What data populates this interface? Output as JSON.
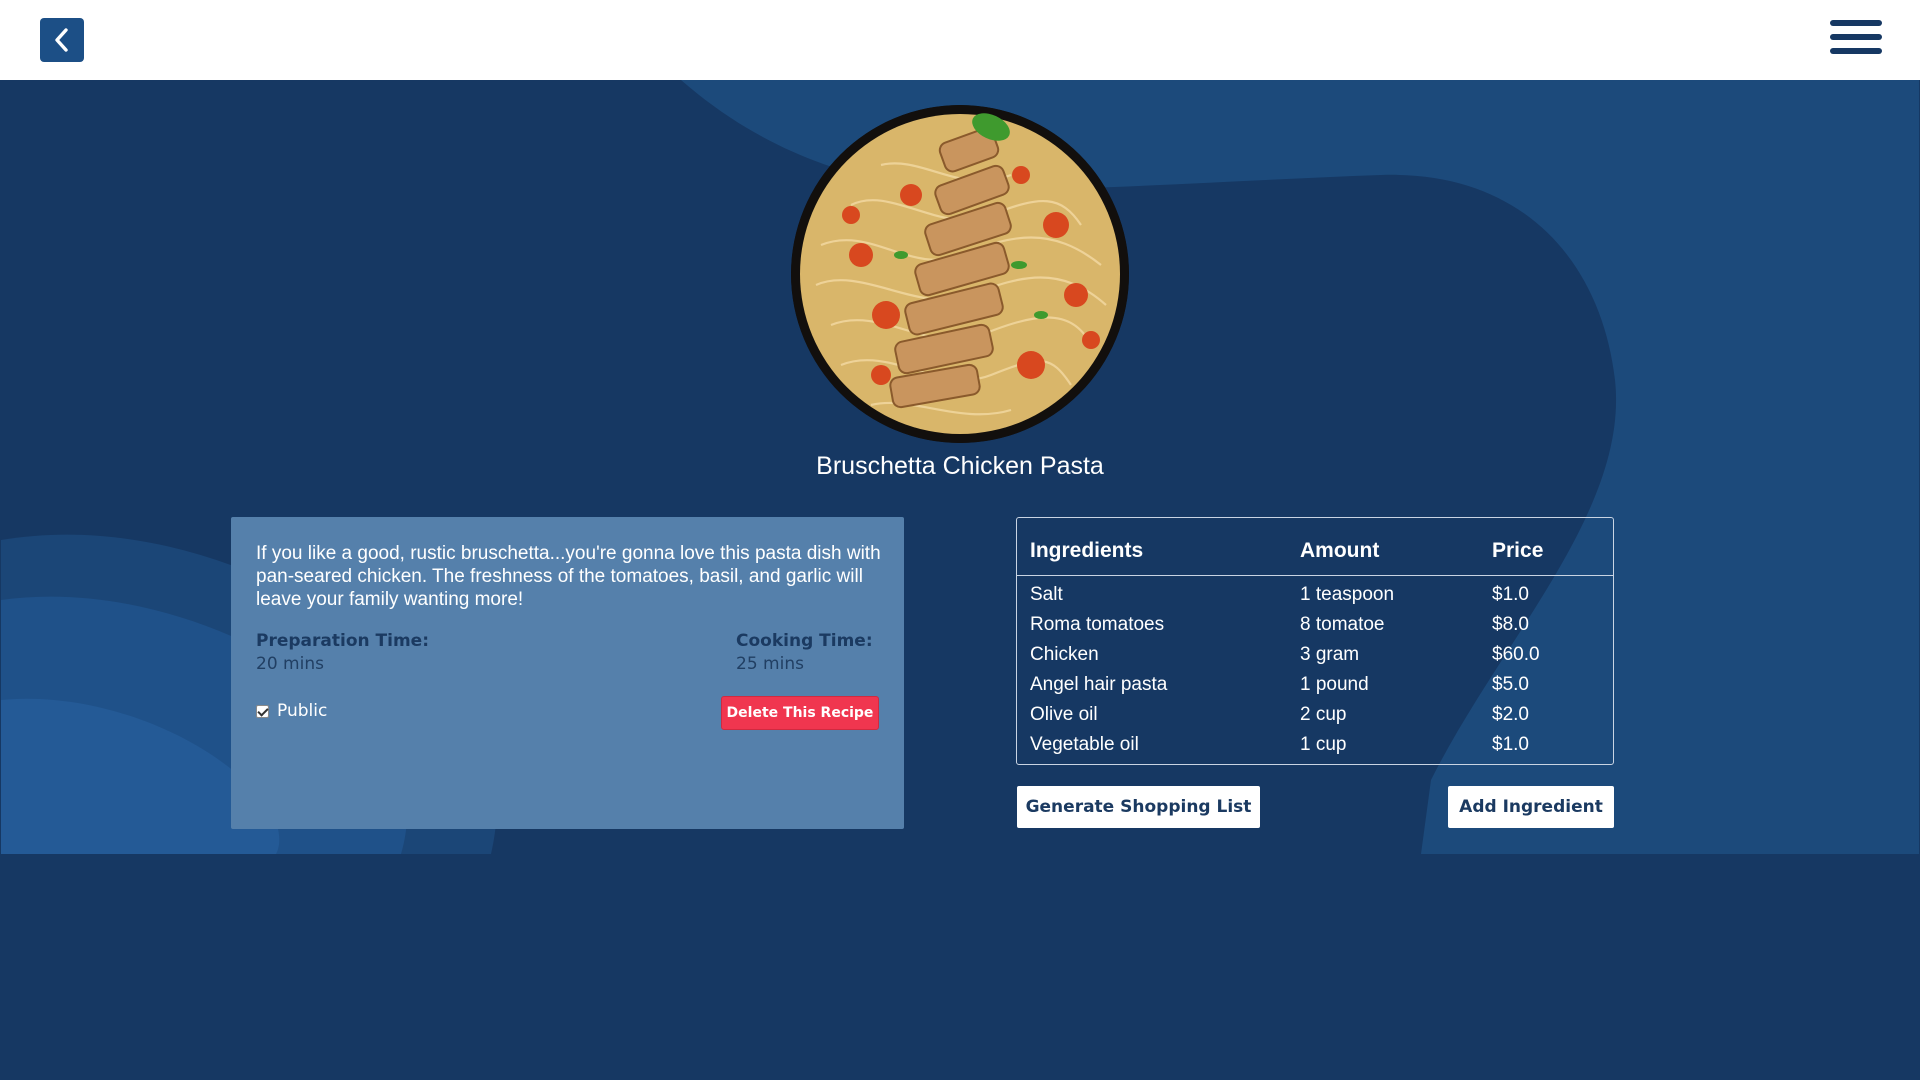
{
  "nav": {
    "back_icon": "chevron-left-icon",
    "menu_icon": "hamburger-menu-icon"
  },
  "recipe": {
    "title": "Bruschetta Chicken Pasta",
    "description": "If you like a good, rustic bruschetta...you're gonna love this pasta dish with pan-seared chicken. The freshness of the tomatoes, basil, and garlic will leave your family wanting more!",
    "prep_label": "Preparation Time:",
    "prep_value": "20 mins",
    "cook_label": "Cooking Time:",
    "cook_value": "25 mins",
    "public_label": "Public",
    "public_checked": true,
    "delete_label": "Delete This Recipe"
  },
  "ingredients": {
    "headers": [
      "Ingredients",
      "Amount",
      "Price"
    ],
    "rows": [
      [
        "Salt",
        "1 teaspoon",
        "$1.0"
      ],
      [
        "Roma tomatoes",
        "8 tomatoe",
        "$8.0"
      ],
      [
        "Chicken",
        "3 gram",
        "$60.0"
      ],
      [
        "Angel hair pasta",
        "1 pound",
        "$5.0"
      ],
      [
        "Olive oil",
        "2 cup",
        "$2.0"
      ],
      [
        "Vegetable oil",
        "1 cup",
        "$1.0"
      ]
    ]
  },
  "actions": {
    "shopping_label": "Generate Shopping List",
    "add_label": "Add Ingredient"
  },
  "colors": {
    "header_bg": "#ffffff",
    "page_bg": "#163863",
    "card_bg": "#5580ab",
    "delete_bg": "#f0364f",
    "accent": "#1c4f86"
  }
}
